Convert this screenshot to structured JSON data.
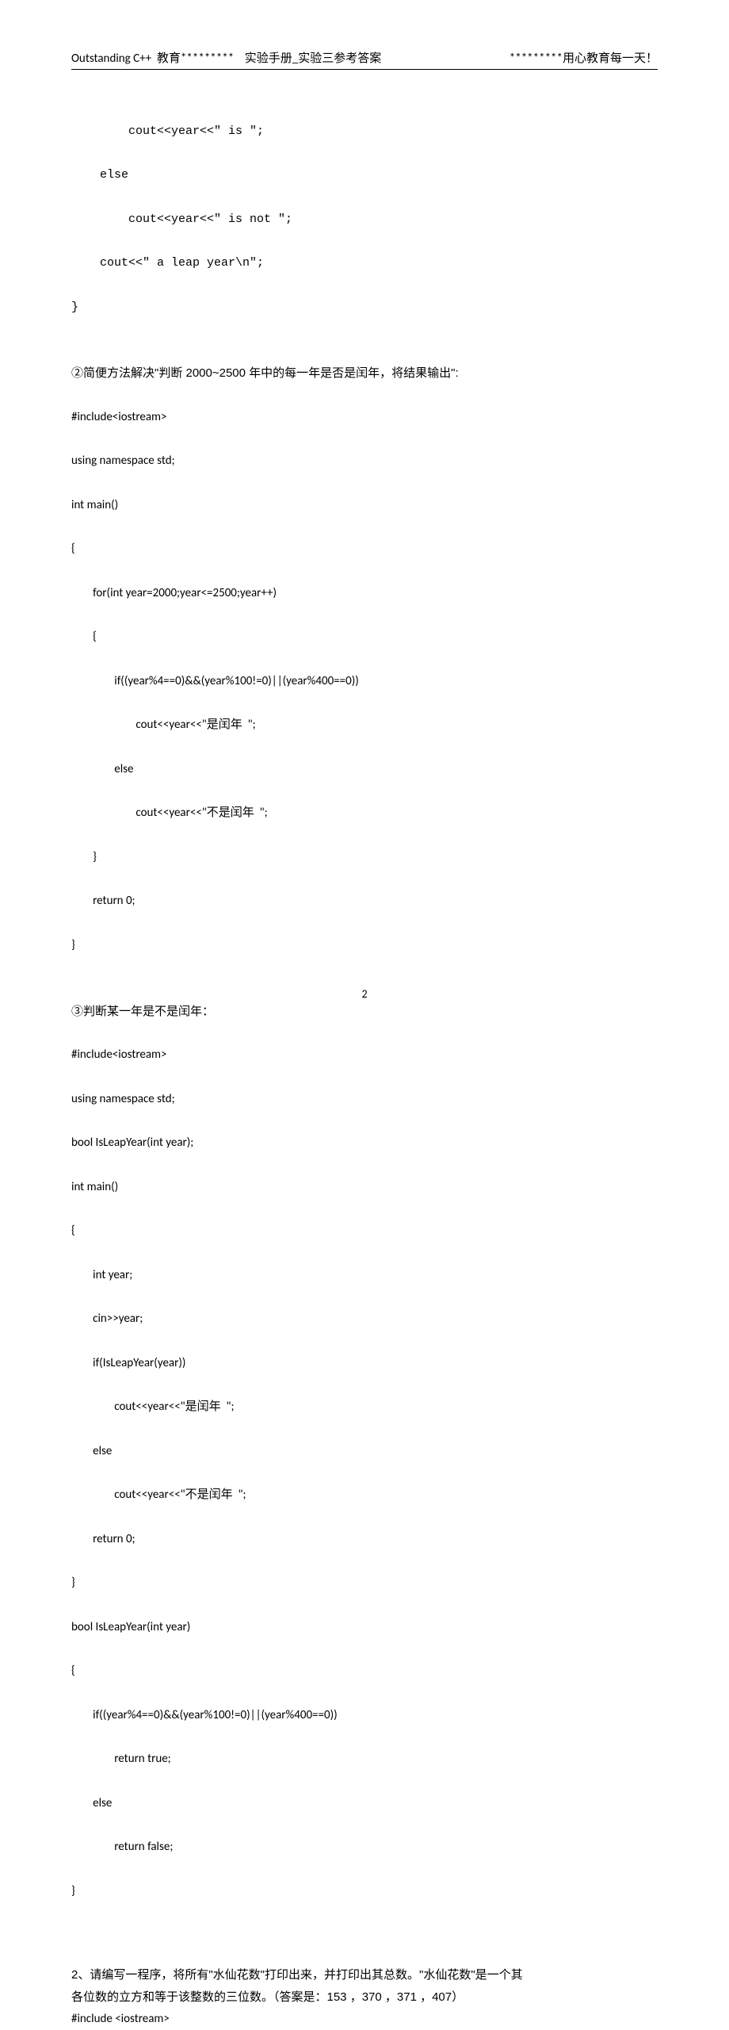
{
  "header": {
    "left": "Outstanding C++  教育*********    实验手册_实验三参考答案",
    "right": "*********用心教育每一天！"
  },
  "block1": {
    "l1": "        cout<<year<<\" is \";",
    "l2": "    else",
    "l3": "        cout<<year<<\" is not \";",
    "l4": "    cout<<\" a leap year\\n\";",
    "l5": "}"
  },
  "note2": "②简便方法解决\"判断 2000~2500 年中的每一年是否是闰年，将结果输出\":",
  "block2": {
    "l1": "#include<iostream>",
    "l2": "using namespace std;",
    "l3": "int main()",
    "l4": "{",
    "l5": "        for(int year=2000;year<=2500;year++)",
    "l6": "        {",
    "l7": "                if((year%4==0)&&(year%100!=0)||(year%400==0))",
    "l8": "                        cout<<year<<\"是闰年  \";",
    "l9": "                else",
    "l10": "                        cout<<year<<\"不是闰年  \";",
    "l11": "        }",
    "l12": "        return 0;",
    "l13": "}"
  },
  "note3": "③判断某一年是不是闰年：",
  "block3": {
    "l1": "#include<iostream>",
    "l2": "using namespace std;",
    "l3": "bool IsLeapYear(int year);",
    "l4": "int main()",
    "l5": "{",
    "l6": "        int year;",
    "l7": "        cin>>year;",
    "l8": "        if(IsLeapYear(year))",
    "l9": "                cout<<year<<\"是闰年  \";",
    "l10": "        else",
    "l11": "                cout<<year<<\"不是闰年  \";",
    "l12": "        return 0;",
    "l13": "}",
    "l14": "bool IsLeapYear(int year)",
    "l15": "{",
    "l16": "        if((year%4==0)&&(year%100!=0)||(year%400==0))",
    "l17": "                return true;",
    "l18": "        else",
    "l19": "                return false;",
    "l20": "}"
  },
  "question2": {
    "p1": "2、请编写一程序，将所有\"水仙花数\"打印出来，并打印出其总数。\"水仙花数\"是一个其",
    "p2": "各位数的立方和等于该整数的三位数。（答案是：153 ，370 ，371 ，407）",
    "p3": "#include <iostream>"
  },
  "pageNumber": "2"
}
